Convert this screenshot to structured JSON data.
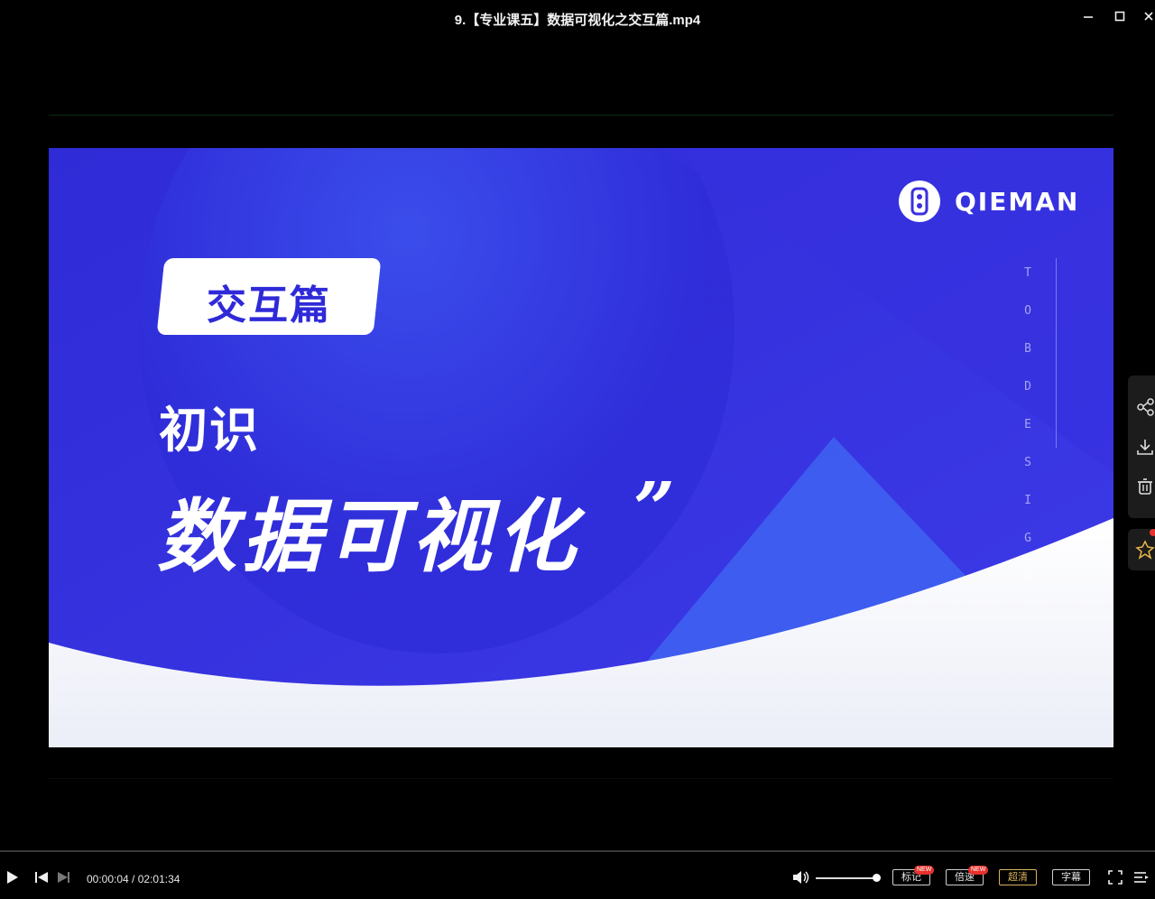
{
  "window": {
    "title": "9.【专业课五】数据可视化之交互篇.mp4"
  },
  "slide": {
    "logo_text": "QIEMAN",
    "vertical_text": "TOBDESIGN",
    "tag": "交互篇",
    "subtitle": "初识",
    "main_title": "数据可视化",
    "quote_mark": "”"
  },
  "side_panel": {
    "icons": [
      "share-icon",
      "download-icon",
      "delete-icon",
      "pin-icon"
    ]
  },
  "player": {
    "current_time": "00:00:04",
    "separator": " / ",
    "duration": "02:01:34",
    "progress": 0.0005,
    "volume": 0.95,
    "buttons": {
      "mark": "标记",
      "speed": "倍速",
      "quality": "超清",
      "subtitle": "字幕"
    },
    "badges": {
      "mark": "NEW",
      "speed": "NEW"
    },
    "colors": {
      "accent": "#d9b25e",
      "badge": "#e5322d",
      "slide_blue": "#3b2fe0"
    }
  }
}
